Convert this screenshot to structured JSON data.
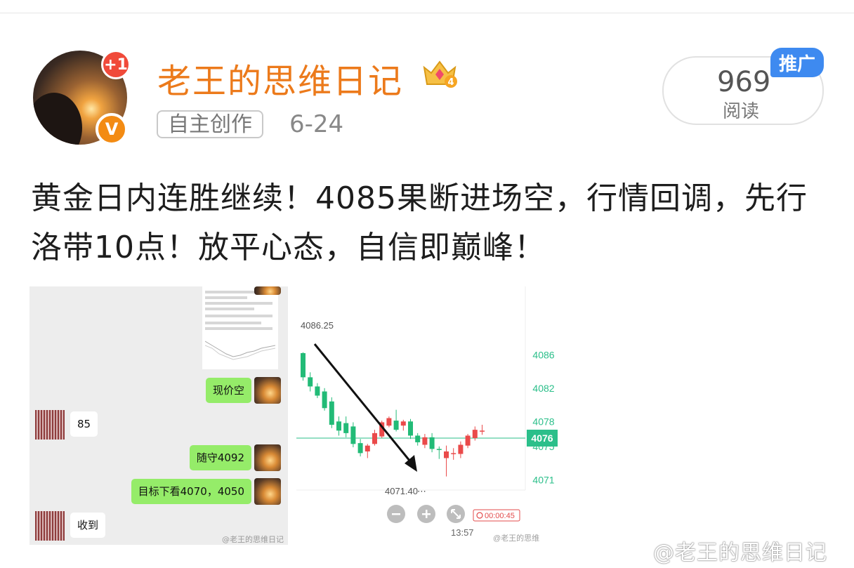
{
  "header": {
    "plus_badge": "+1",
    "verified_badge": "V",
    "username": "老王的思维日记",
    "crown_level": "4",
    "tag": "自主创作",
    "date": "6-24",
    "reads_count": "969",
    "reads_label": "阅读",
    "promo_label": "推广"
  },
  "post": {
    "text": "黄金日内连胜继续！4085果断进场空，行情回调，先行洛带10点！放平心态，自信即巅峰！"
  },
  "chat_image": {
    "messages": [
      {
        "side": "right",
        "text": "现价空"
      },
      {
        "side": "left",
        "text": "85"
      },
      {
        "side": "right",
        "text": "随守4092"
      },
      {
        "side": "right",
        "text": "目标下看4070，4050"
      },
      {
        "side": "left",
        "text": "收到"
      }
    ],
    "watermark": "@老王的思维日记"
  },
  "chart_image": {
    "high_label": "4086.25",
    "low_label": "4071.40",
    "current_price": "4076",
    "time_label": "13:57",
    "timer": "00:00:45",
    "watermark": "@老王的思维",
    "colors": {
      "up": "#ea4a4a",
      "down": "#22bb77",
      "price_line": "#2bbf8a"
    }
  },
  "chart_data": {
    "type": "candlestick",
    "y_ticks": [
      4086,
      4082,
      4078,
      4075,
      4071
    ],
    "annotations": [
      "4086.25",
      "4071.40"
    ],
    "current": 4076
  },
  "footer": {
    "watermark": "@老王的思维日记"
  }
}
